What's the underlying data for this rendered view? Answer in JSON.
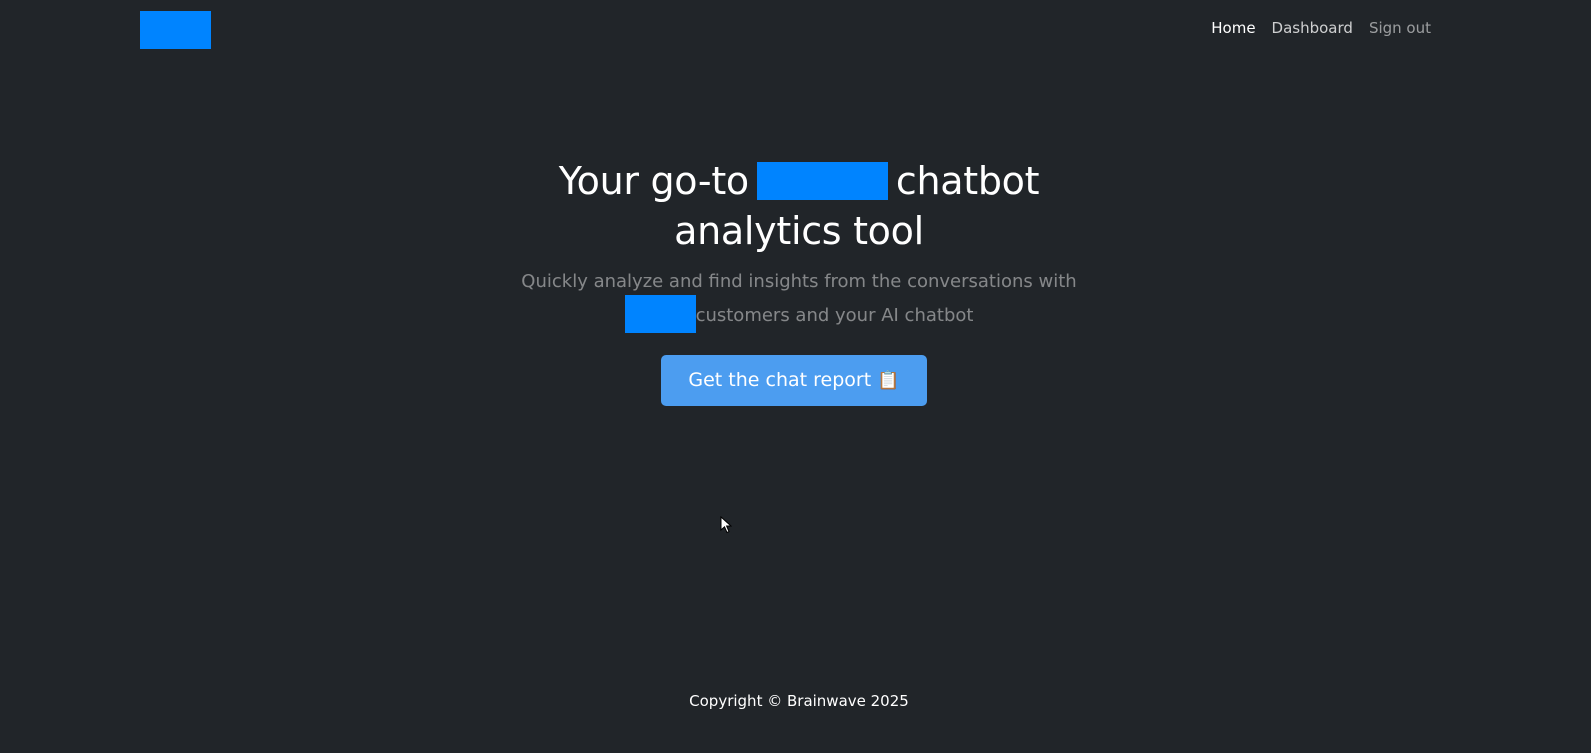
{
  "nav": {
    "logo_label": "",
    "links": [
      {
        "label": "Home"
      },
      {
        "label": "Dashboard"
      },
      {
        "label": "Sign out"
      }
    ]
  },
  "hero": {
    "title_part1": "Your go-to",
    "title_part2": "chatbot",
    "title_line2": "analytics tool",
    "subtitle_line1": "Quickly analyze and find insights from the conversations with",
    "subtitle_line2": "customers and your AI chatbot",
    "cta_label": "Get the chat report",
    "cta_icon": "📋"
  },
  "footer": {
    "copyright": "Copyright © Brainwave 2025"
  },
  "colors": {
    "background": "#212529",
    "redaction": "#0084ff",
    "cta_background": "#4c9df0"
  },
  "icons": {
    "cta": "clipboard-icon",
    "cursor": "mouse-pointer-icon"
  }
}
